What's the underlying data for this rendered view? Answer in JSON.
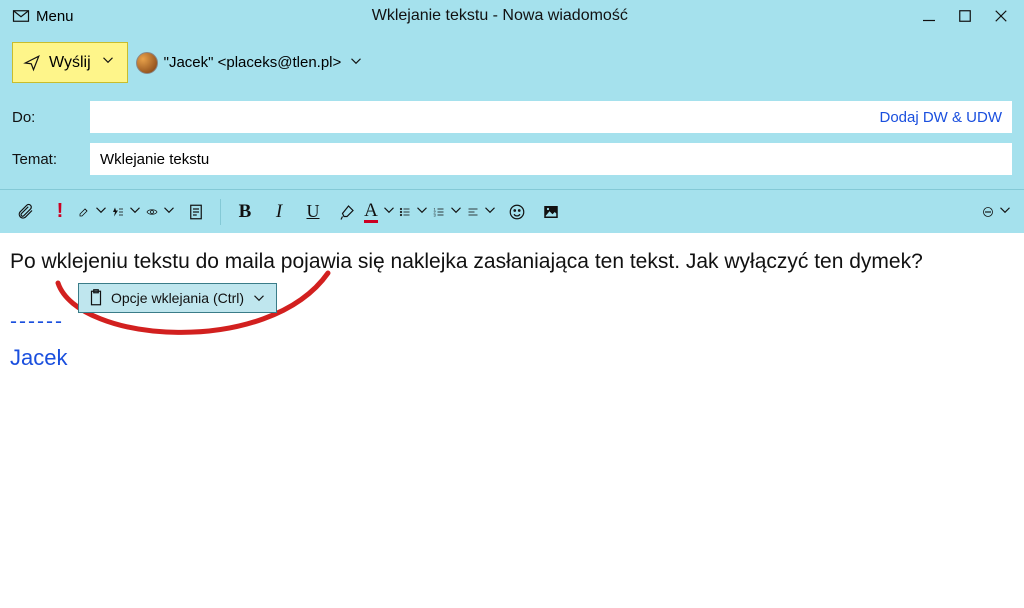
{
  "titlebar": {
    "menu": "Menu",
    "title": "Wklejanie tekstu - Nowa wiadomość"
  },
  "send": {
    "label": "Wyślij"
  },
  "from": {
    "display": "\"Jacek\" <placeks@tlen.pl>"
  },
  "fields": {
    "to_label": "Do:",
    "to_value": "",
    "cc_link": "Dodaj DW & UDW",
    "subject_label": "Temat:",
    "subject_value": "Wklejanie tekstu"
  },
  "body": {
    "text": "Po wklejeniu tekstu do maila pojawia się naklejka zasłaniająca ten tekst. Jak wyłączyć ten dymek?",
    "sig_sep": "------",
    "sig_name": "Jacek"
  },
  "paste_popup": {
    "label": "Opcje wklejania (Ctrl)"
  }
}
